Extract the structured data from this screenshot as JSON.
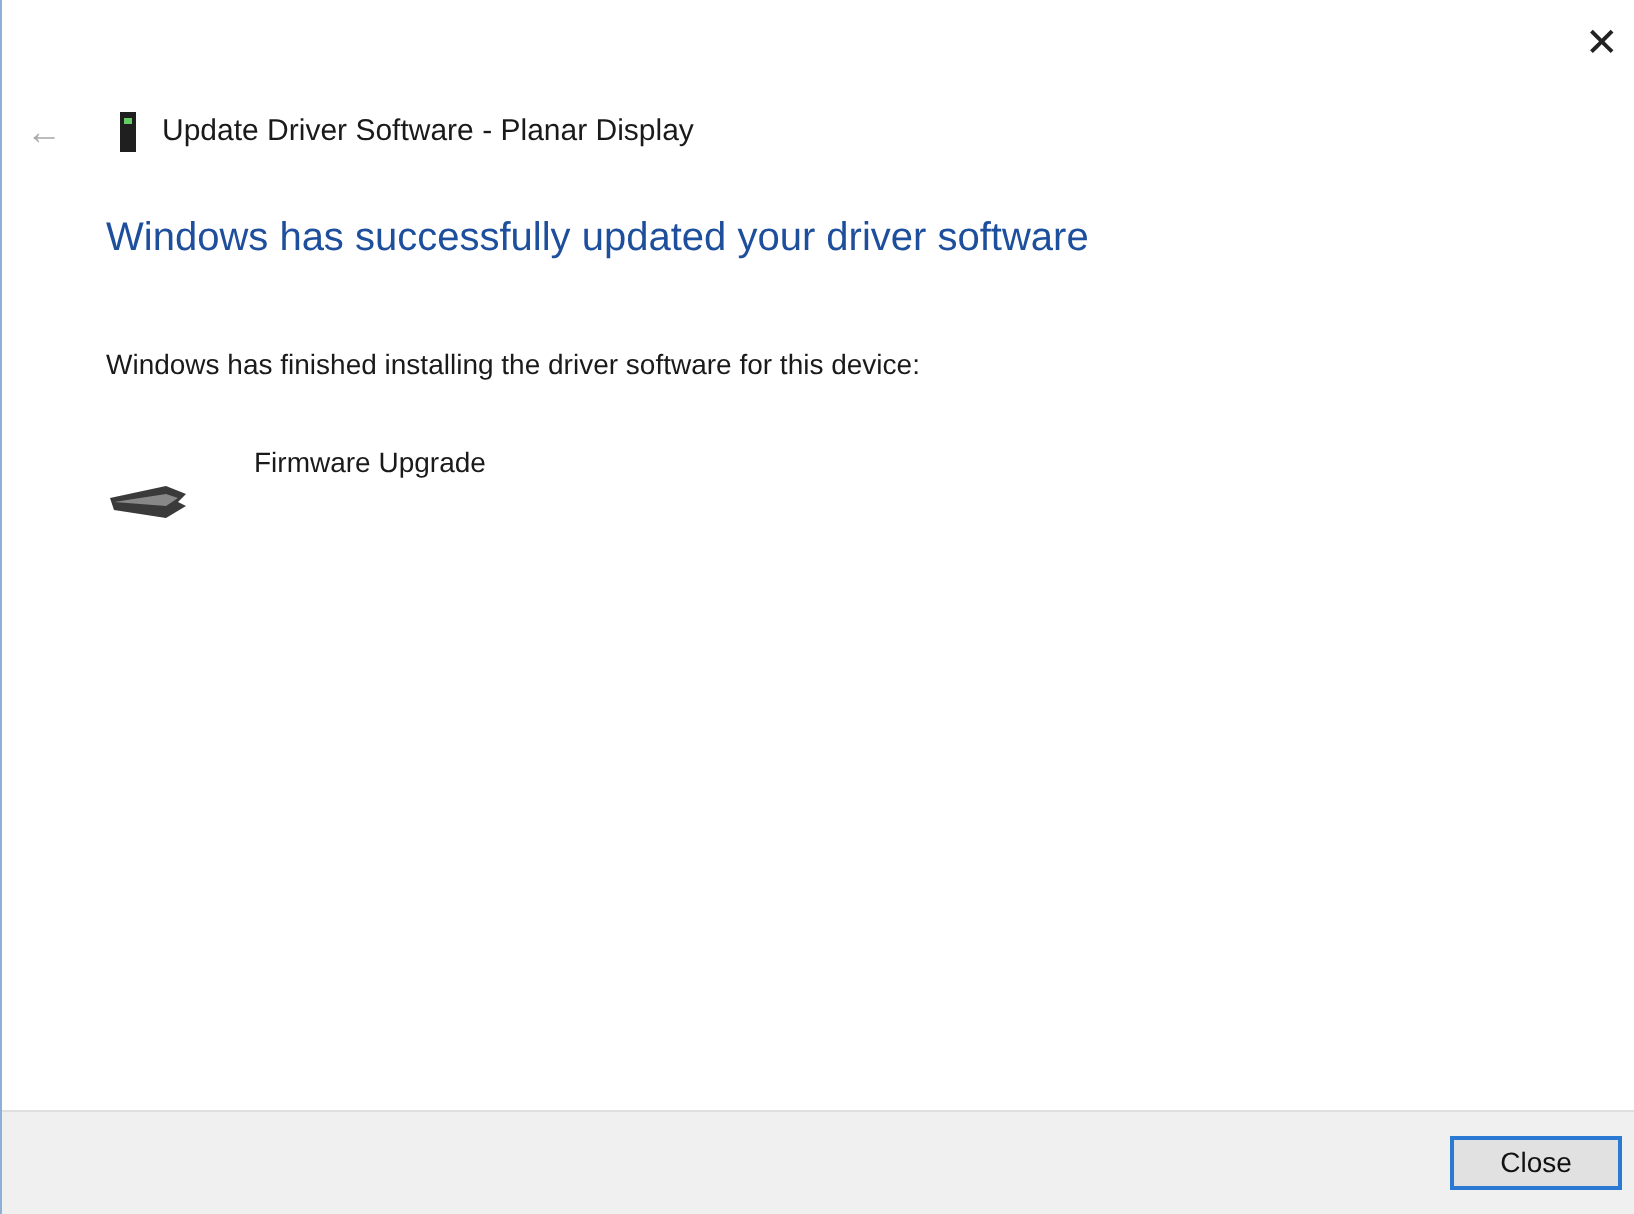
{
  "window": {
    "close_glyph": "✕"
  },
  "header": {
    "back_glyph": "←",
    "title": "Update Driver Software - Planar Display"
  },
  "heading": "Windows has successfully updated your driver software",
  "message": "Windows has finished installing the driver software for this device:",
  "device": {
    "name": "Firmware Upgrade"
  },
  "buttons": [
    {
      "label": "Close",
      "default": true
    }
  ]
}
